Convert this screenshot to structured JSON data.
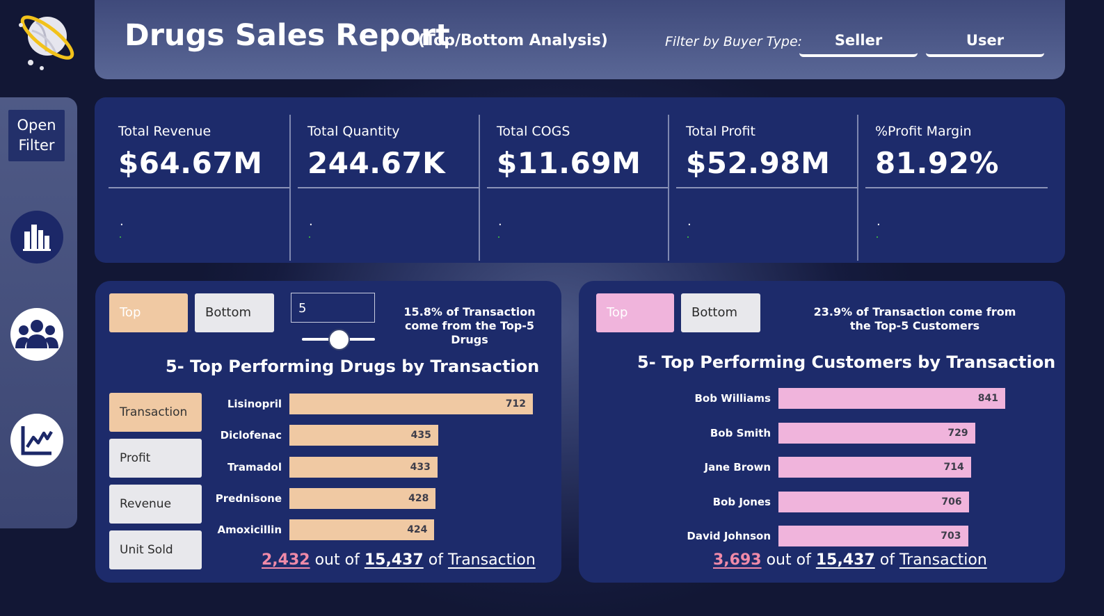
{
  "header": {
    "title": "Drugs Sales Report",
    "subtitle": "(Top/Bottom Analysis)",
    "filter_label": "Filter by Buyer Type:",
    "buyer_types": [
      "Seller",
      "User"
    ]
  },
  "sidebar": {
    "open_filter_line1": "Open",
    "open_filter_line2": "Filter",
    "nav_icons": [
      "bar-chart-icon",
      "people-icon",
      "trend-chart-icon"
    ]
  },
  "kpis": [
    {
      "label": "Total Revenue",
      "value": "$64.67M",
      "note": "."
    },
    {
      "label": "Total Quantity",
      "value": "244.67K",
      "note": "."
    },
    {
      "label": "Total COGS",
      "value": "$11.69M",
      "note": "."
    },
    {
      "label": "Total Profit",
      "value": "$52.98M",
      "note": "."
    },
    {
      "label": "%Profit Margin",
      "value": "81.92%",
      "note": "."
    }
  ],
  "drugs_panel": {
    "top_label": "Top",
    "bottom_label": "Bottom",
    "topn_value": "5",
    "note": "15.8% of Transaction come from the Top-5 Drugs",
    "chart_title": "5- Top Performing Drugs by Transaction",
    "metric_buttons": [
      "Transaction",
      "Profit",
      "Revenue",
      "Unit Sold"
    ],
    "footer": {
      "count": "2,432",
      "out_of": "out of",
      "total": "15,437",
      "of": "of",
      "measure": "Transaction"
    }
  },
  "customers_panel": {
    "top_label": "Top",
    "bottom_label": "Bottom",
    "note": "23.9% of Transaction come from the Top-5 Customers",
    "chart_title": "5- Top Performing Customers by Transaction",
    "footer": {
      "count": "3,693",
      "out_of": "out of",
      "total": "15,437",
      "of": "of",
      "measure": "Transaction"
    }
  },
  "colors": {
    "peach": "#f0c9a3",
    "pink": "#f0b4dc",
    "panel": "#1d2b6b",
    "highlight": "#f08aa8"
  },
  "chart_data": [
    {
      "type": "bar",
      "orientation": "horizontal",
      "title": "5- Top Performing Drugs by Transaction",
      "categories": [
        "Lisinopril",
        "Diclofenac",
        "Tramadol",
        "Prednisone",
        "Amoxicillin"
      ],
      "values": [
        712,
        435,
        433,
        428,
        424
      ],
      "color": "#f0c9a3"
    },
    {
      "type": "bar",
      "orientation": "horizontal",
      "title": "5- Top Performing Customers by Transaction",
      "categories": [
        "Bob Williams",
        "Bob Smith",
        "Jane Brown",
        "Bob Jones",
        "David Johnson"
      ],
      "values": [
        841,
        729,
        714,
        706,
        703
      ],
      "color": "#f0b4dc"
    }
  ]
}
